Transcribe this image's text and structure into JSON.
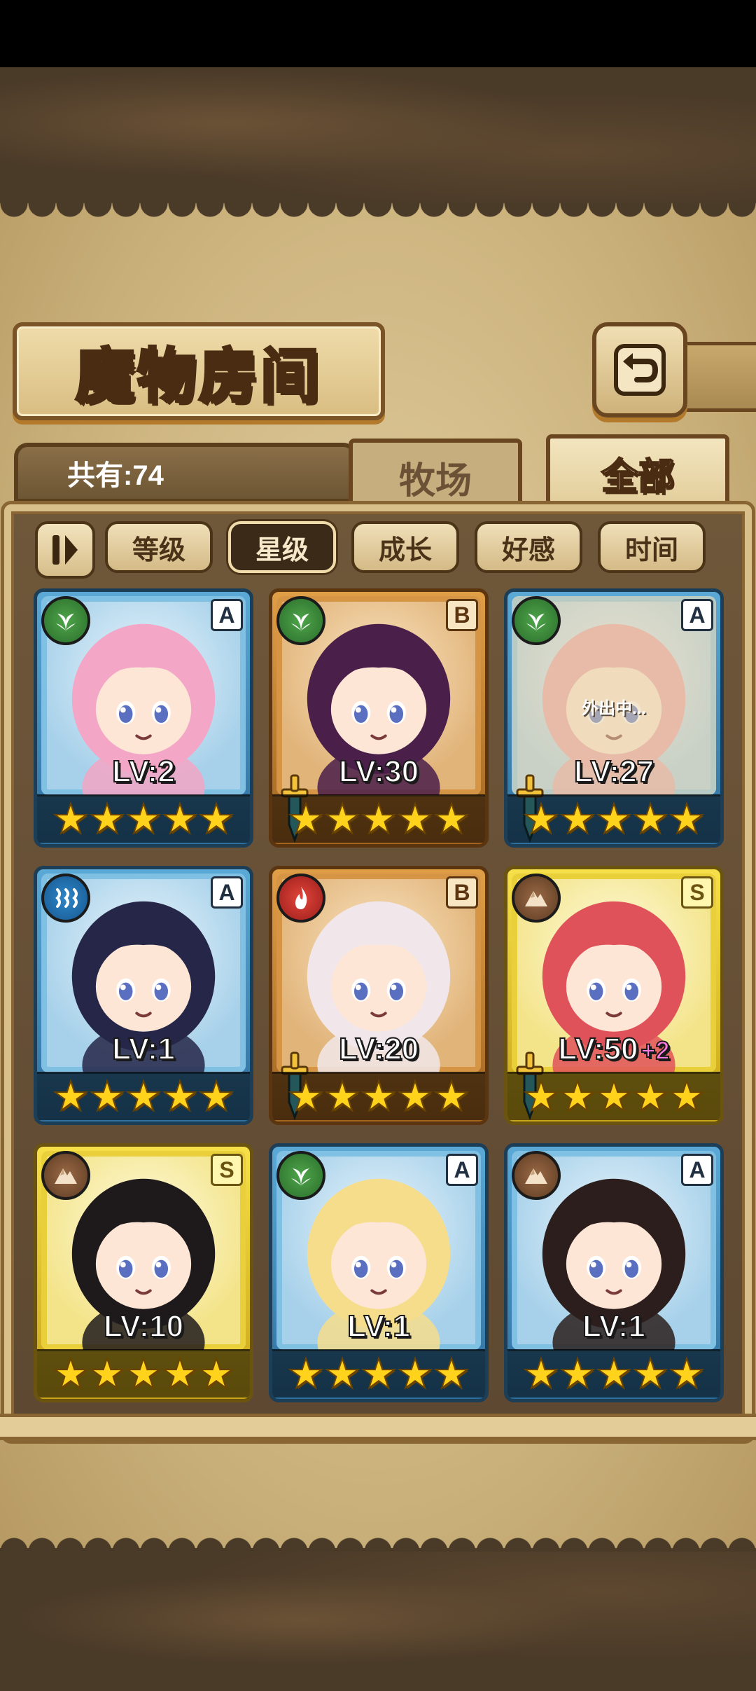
{
  "screen": {
    "title": "魔物房间",
    "count_label": "共有:74",
    "tabs": [
      {
        "label": "牧场",
        "active": false
      },
      {
        "label": "全部",
        "active": true
      }
    ],
    "sort_buttons": [
      {
        "label": "等级",
        "active": false
      },
      {
        "label": "星级",
        "active": true
      },
      {
        "label": "成长",
        "active": false
      },
      {
        "label": "好感",
        "active": false
      },
      {
        "label": "时间",
        "active": false
      }
    ]
  },
  "monsters": [
    {
      "element": "wood",
      "element_icon": "leaf-icon",
      "rank": "A",
      "frame": "blue",
      "level": "LV:2",
      "bonus": "",
      "stars": 5,
      "status": "",
      "equipped": false,
      "hair": "#f3a6c6"
    },
    {
      "element": "wood",
      "element_icon": "leaf-icon",
      "rank": "B",
      "frame": "bronze",
      "level": "LV:30",
      "bonus": "",
      "stars": 5,
      "status": "",
      "equipped": true,
      "hair": "#4a1f4a"
    },
    {
      "element": "wood",
      "element_icon": "leaf-icon",
      "rank": "A",
      "frame": "blue",
      "level": "LV:27",
      "bonus": "",
      "stars": 5,
      "status": "外出中...",
      "equipped": true,
      "hair": "#e8a0a6"
    },
    {
      "element": "water",
      "element_icon": "water-waves-icon",
      "rank": "A",
      "frame": "blue",
      "level": "LV:1",
      "bonus": "",
      "stars": 5,
      "status": "",
      "equipped": false,
      "hair": "#252648"
    },
    {
      "element": "fire",
      "element_icon": "flame-icon",
      "rank": "B",
      "frame": "bronze",
      "level": "LV:20",
      "bonus": "",
      "stars": 5,
      "status": "",
      "equipped": true,
      "hair": "#f1e7ea"
    },
    {
      "element": "earth",
      "element_icon": "mountain-icon",
      "rank": "S",
      "frame": "gold",
      "level": "LV:50",
      "bonus": "+2",
      "stars": 5,
      "status": "",
      "equipped": true,
      "hair": "#e0525a"
    },
    {
      "element": "earth",
      "element_icon": "mountain-icon",
      "rank": "S",
      "frame": "gold",
      "level": "LV:10",
      "bonus": "",
      "stars": 5,
      "status": "",
      "equipped": false,
      "hair": "#1e1a1c"
    },
    {
      "element": "wood",
      "element_icon": "leaf-icon",
      "rank": "A",
      "frame": "blue",
      "level": "LV:1",
      "bonus": "",
      "stars": 5,
      "status": "",
      "equipped": false,
      "hair": "#f6dd8c"
    },
    {
      "element": "earth",
      "element_icon": "mountain-icon",
      "rank": "A",
      "frame": "blue",
      "level": "LV:1",
      "bonus": "",
      "stars": 5,
      "status": "",
      "equipped": false,
      "hair": "#2c1e1c"
    }
  ]
}
